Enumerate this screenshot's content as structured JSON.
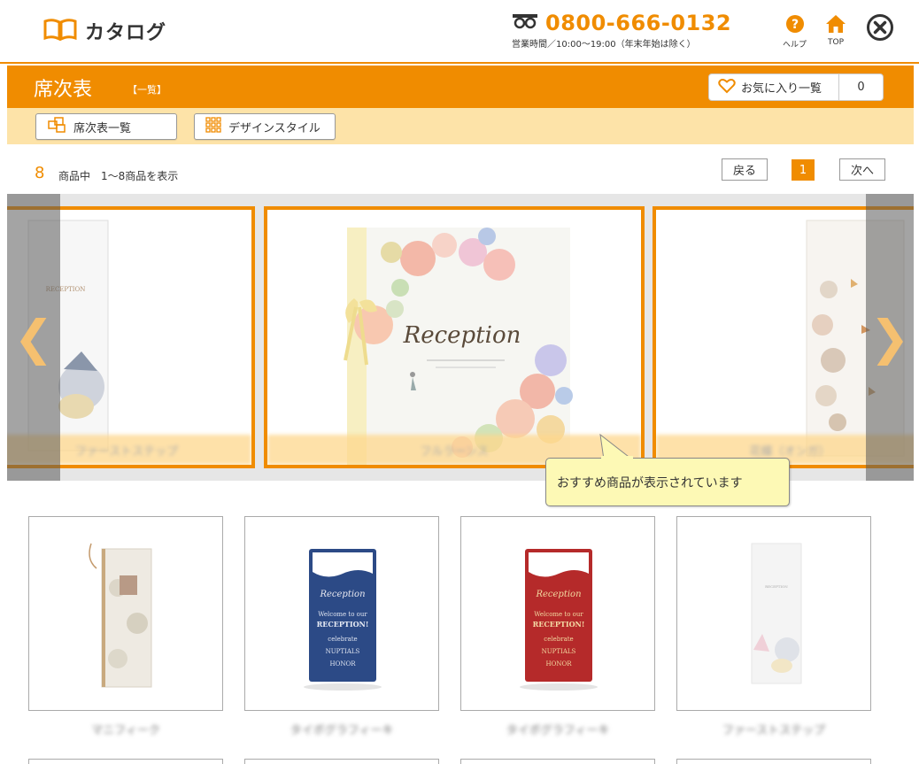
{
  "header": {
    "logo_text": "カタログ",
    "phone_number": "0800-666-0132",
    "phone_hours": "営業時間／10:00〜19:00（年末年始は除く）",
    "help_label": "ヘルプ",
    "top_label": "TOP"
  },
  "titlebar": {
    "title": "席次表",
    "subtitle": "【一覧】",
    "favorites_label": "お気に入り一覧",
    "favorites_count": "0"
  },
  "toolbar": {
    "list_button": "席次表一覧",
    "design_button": "デザインスタイル"
  },
  "results": {
    "count": "8",
    "summary": "商品中　1〜8商品を表示",
    "prev_label": "戻る",
    "current_page": "1",
    "next_label": "次へ"
  },
  "carousel": {
    "prev_arrow": "❮",
    "next_arrow": "❯",
    "cards": [
      {
        "caption": "ファーストステップ",
        "cover_text": "RECEPTION"
      },
      {
        "caption": "フルラーンス",
        "cover_text": "Reception"
      },
      {
        "caption": "花蝶（オンガ）",
        "cover_text": ""
      }
    ]
  },
  "tooltip": {
    "text": "おすすめ商品が表示されています"
  },
  "products": [
    {
      "name": "マニフィーク",
      "color": "#eeeae2"
    },
    {
      "name": "タイポグラフィーキ",
      "color": "#2c4a86"
    },
    {
      "name": "タイポグラフィーキ",
      "color": "#b52a2a"
    },
    {
      "name": "ファーストステップ",
      "color": "#f4f4f4"
    }
  ],
  "colors": {
    "accent": "#f08c00",
    "subbar": "#fde3a8"
  }
}
